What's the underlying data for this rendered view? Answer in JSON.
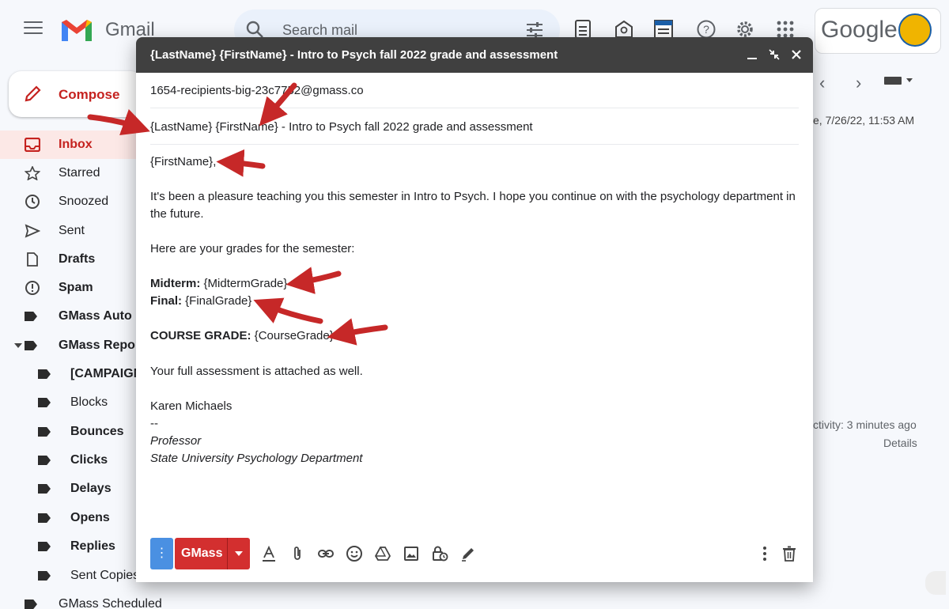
{
  "app": {
    "brand": "Gmail",
    "search_placeholder": "Search mail",
    "google_word": "Google"
  },
  "sidebar": {
    "compose_label": "Compose",
    "items": [
      {
        "label": "Inbox"
      },
      {
        "label": "Starred"
      },
      {
        "label": "Snoozed"
      },
      {
        "label": "Sent"
      },
      {
        "label": "Drafts"
      },
      {
        "label": "Spam"
      },
      {
        "label": "GMass Auto F"
      },
      {
        "label": "GMass Repor"
      },
      {
        "label": "[CAMPAIGN"
      },
      {
        "label": "Blocks"
      },
      {
        "label": "Bounces"
      },
      {
        "label": "Clicks"
      },
      {
        "label": "Delays"
      },
      {
        "label": "Opens"
      },
      {
        "label": "Replies"
      },
      {
        "label": "Sent Copies"
      },
      {
        "label": "GMass Scheduled"
      }
    ]
  },
  "background": {
    "date_text": "e, 7/26/22, 11:53 AM",
    "activity_text": "ctivity: 3 minutes ago",
    "details_text": "Details"
  },
  "compose": {
    "window_title": "{LastName} {FirstName} - Intro to Psych fall 2022 grade and assessment",
    "to": "1654-recipients-big-23c7752@gmass.co",
    "subject": "{LastName} {FirstName} - Intro to Psych fall 2022 grade and assessment",
    "body": {
      "greeting": "{FirstName},",
      "para1_line1": "It's been a pleasure teaching you this semester in Intro to Psych. I hope you continue on with the psychology department in",
      "para1_line2": "the future.",
      "para2": "Here are your grades for the semester:",
      "midterm_label": "Midterm:",
      "midterm_value": " {MidtermGrade}",
      "final_label": "Final:",
      "final_value": " {FinalGrade}",
      "course_label": "COURSE GRADE:",
      "course_value": " {CourseGrade}",
      "para3": "Your full assessment is attached as well.",
      "sig_name": "Karen Michaels",
      "sig_sep": "--",
      "sig_title": "Professor",
      "sig_dept": "State University Psychology Department"
    },
    "toolbar": {
      "options_dots": "⋮",
      "gmass_label": "GMass"
    }
  },
  "colors": {
    "gmass_red": "#d32f2f",
    "arrow_red": "#c62828",
    "header_dark": "#404040"
  }
}
